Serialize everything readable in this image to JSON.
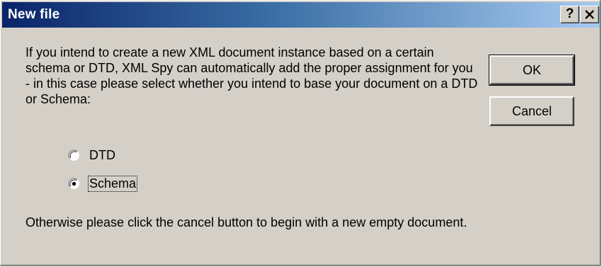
{
  "window": {
    "title": "New file",
    "help_label": "?"
  },
  "message": {
    "main": "If you intend to create a new XML document instance based on a certain schema or DTD, XML Spy can automatically add the proper assignment for you - in this case please select whether you intend to base your document on a DTD or Schema:",
    "footer": "Otherwise please click the cancel button to begin with a new empty document."
  },
  "buttons": {
    "ok_label": "OK",
    "cancel_label": "Cancel"
  },
  "options": [
    {
      "label": "DTD",
      "selected": false
    },
    {
      "label": "Schema",
      "selected": true
    }
  ]
}
